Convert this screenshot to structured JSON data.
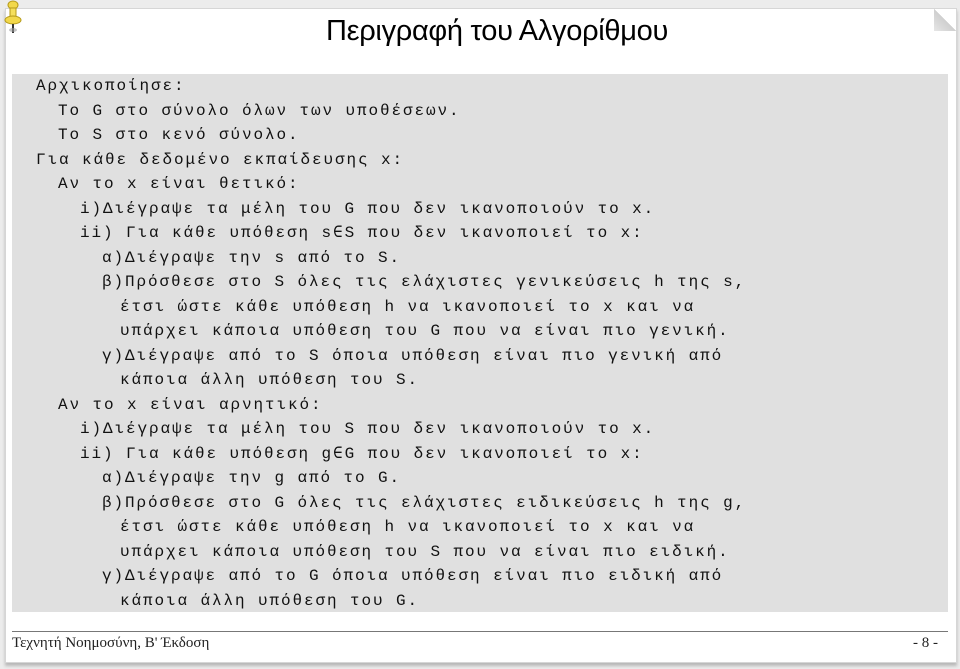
{
  "slide": {
    "title": "Περιγραφή του Αλγορίθμου",
    "footer_left": "Τεχνητή Νοημοσύνη, B' Έκδοση",
    "footer_right": "- 8 -"
  },
  "algorithm": {
    "lines": [
      {
        "indent": 0,
        "label": "",
        "text": "Αρχικοποίησε:"
      },
      {
        "indent": 1,
        "label": "",
        "text": "Το G στο σύνολο όλων των υποθέσεων."
      },
      {
        "indent": 1,
        "label": "",
        "text": "Το S στο κενό σύνολο."
      },
      {
        "indent": 0,
        "label": "",
        "text": "Για κάθε δεδομένο εκπαίδευσης x:"
      },
      {
        "indent": 1,
        "label": "",
        "text": "Αν το x είναι θετικό:"
      },
      {
        "indent": 2,
        "label": "i)",
        "text": "Διέγραψε τα μέλη του G που δεν ικανοποιούν το x."
      },
      {
        "indent": 2,
        "label": "ii) ",
        "text": "Για κάθε υπόθεση s∈S που δεν ικανοποιεί το x:"
      },
      {
        "indent": 3,
        "label": "α)",
        "text": "Διέγραψε την s από το S."
      },
      {
        "indent": 3,
        "label": "β)",
        "text": "Πρόσθεσε στο S όλες τις ελάχιστες γενικεύσεις h της s,"
      },
      {
        "indent": 4,
        "label": "",
        "text": "έτσι ώστε κάθε υπόθεση h να ικανοποιεί το x και να"
      },
      {
        "indent": 4,
        "label": "",
        "text": "υπάρχει κάποια υπόθεση του G που να είναι πιο γενική."
      },
      {
        "indent": 3,
        "label": "γ)",
        "text": "Διέγραψε από το S όποια υπόθεση είναι πιο γενική από"
      },
      {
        "indent": 4,
        "label": "",
        "text": "κάποια άλλη υπόθεση του S."
      },
      {
        "indent": 1,
        "label": "",
        "text": "Αν το x είναι αρνητικό:"
      },
      {
        "indent": 2,
        "label": "i)",
        "text": "Διέγραψε τα μέλη του S που δεν ικανοποιούν το x."
      },
      {
        "indent": 2,
        "label": "ii) ",
        "text": "Για κάθε υπόθεση g∈G που δεν ικανοποιεί το x:"
      },
      {
        "indent": 3,
        "label": "α)",
        "text": "Διέγραψε την g από το G."
      },
      {
        "indent": 3,
        "label": "β)",
        "text": "Πρόσθεσε στο G όλες τις ελάχιστες ειδικεύσεις h της g,"
      },
      {
        "indent": 4,
        "label": "",
        "text": "έτσι ώστε κάθε υπόθεση h να ικανοποιεί το x και να"
      },
      {
        "indent": 4,
        "label": "",
        "text": "υπάρχει κάποια υπόθεση του S που να είναι πιο ειδική."
      },
      {
        "indent": 3,
        "label": "γ)",
        "text": "Διέγραψε από το G όποια υπόθεση είναι πιο ειδική από"
      },
      {
        "indent": 4,
        "label": "",
        "text": "κάποια άλλη υπόθεση του G."
      }
    ]
  }
}
